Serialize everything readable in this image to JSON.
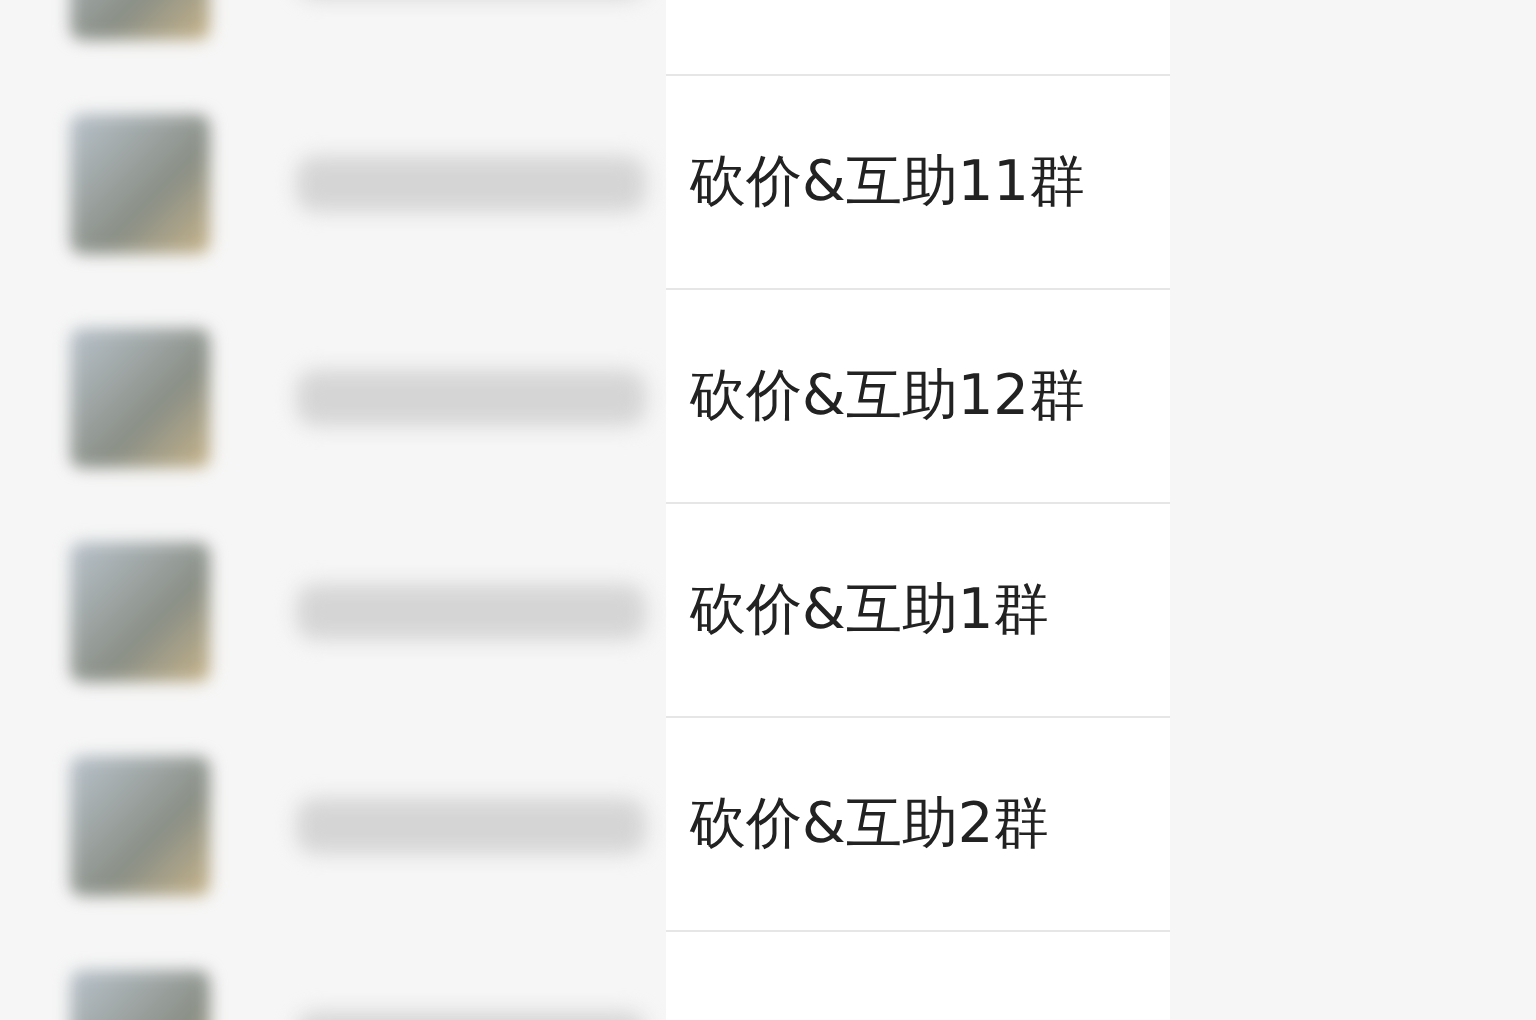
{
  "chats": [
    {
      "name": "砍价&互助11群"
    },
    {
      "name": "砍价&互助12群"
    },
    {
      "name": "砍价&互助1群"
    },
    {
      "name": "砍价&互助2群"
    }
  ]
}
